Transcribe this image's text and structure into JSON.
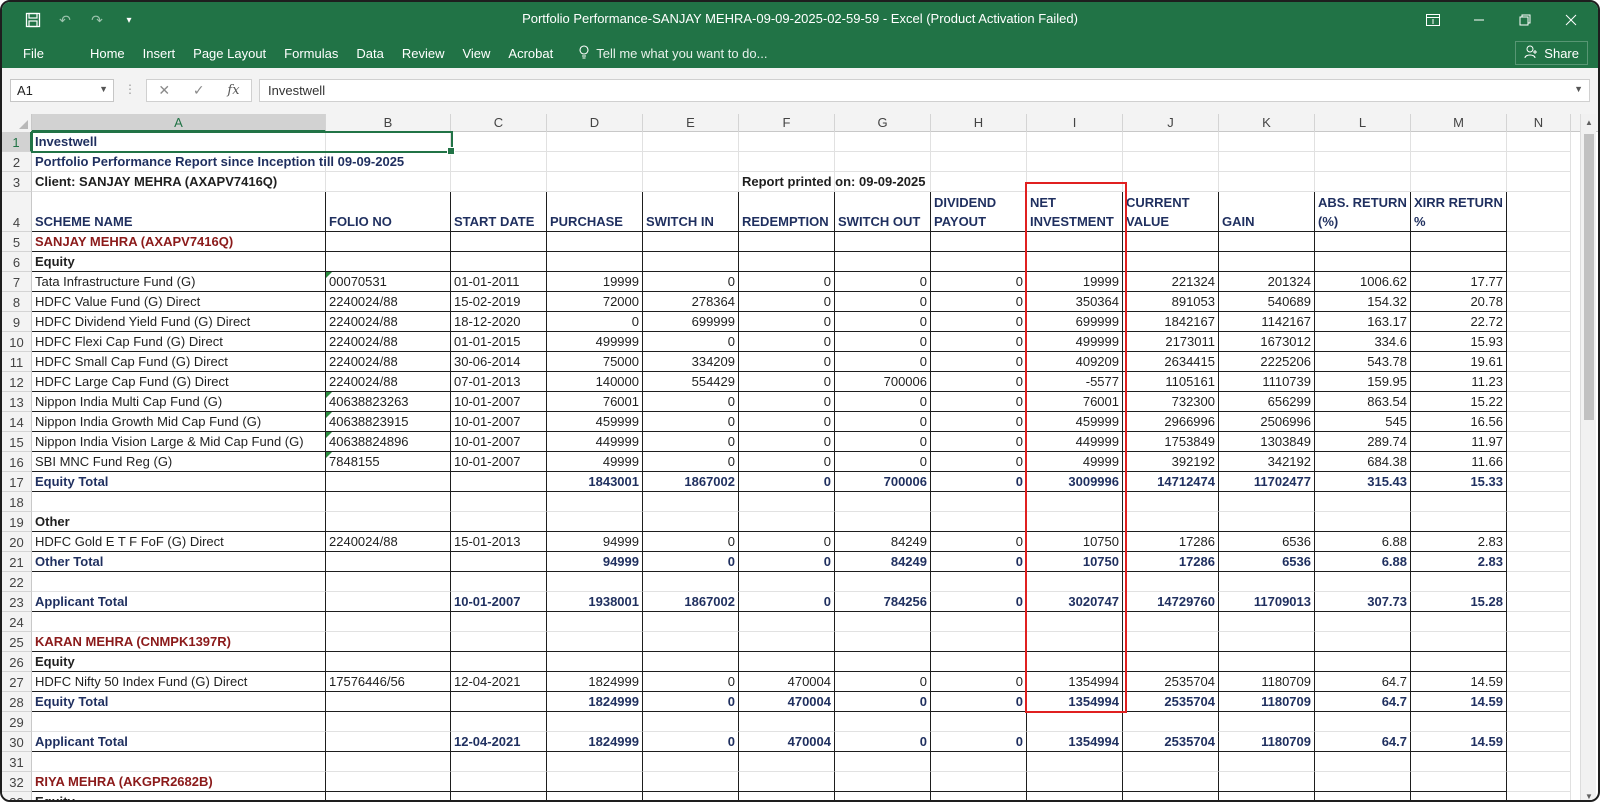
{
  "window": {
    "title": "Portfolio Performance-SANJAY MEHRA-09-09-2025-02-59-59  -  Excel (Product Activation Failed)"
  },
  "ribbon": {
    "tabs": [
      "File",
      "Home",
      "Insert",
      "Page Layout",
      "Formulas",
      "Data",
      "Review",
      "View",
      "Acrobat"
    ],
    "tell_me": "Tell me what you want to do...",
    "share": "Share"
  },
  "formula_bar": {
    "name_box": "A1",
    "content": "Investwell"
  },
  "columns": [
    "A",
    "B",
    "C",
    "D",
    "E",
    "F",
    "G",
    "H",
    "I",
    "J",
    "K",
    "L",
    "M",
    "N"
  ],
  "header_row": {
    "scheme_name": "SCHEME NAME",
    "folio_no": "FOLIO NO",
    "start_date": "START DATE",
    "purchase": "PURCHASE",
    "switch_in": "SWITCH IN",
    "redemption": "REDEMPTION",
    "switch_out": "SWITCH OUT",
    "dividend_payout": "DIVIDEND PAYOUT",
    "net_investment": "NET INVESTMENT",
    "current_value": "CURRENT VALUE",
    "gain": "GAIN",
    "abs_return": "ABS.  RETURN (%)",
    "xirr_return": "XIRR RETURN %"
  },
  "rows": [
    {
      "num": "1",
      "cells": {
        "A": "Investwell"
      },
      "style": "title"
    },
    {
      "num": "2",
      "cells": {
        "A": "Portfolio Performance Report since Inception till 09-09-2025"
      },
      "style": "title"
    },
    {
      "num": "3",
      "cells": {
        "A": "Client: SANJAY MEHRA (AXAPV7416Q)",
        "F": "Report printed on: 09-09-2025"
      },
      "style": "client"
    },
    {
      "num": "4",
      "cells": {},
      "style": "header"
    },
    {
      "num": "5",
      "cells": {
        "A": "SANJAY MEHRA (AXAPV7416Q)"
      },
      "style": "applicant"
    },
    {
      "num": "6",
      "cells": {
        "A": "Equity"
      },
      "style": "category"
    },
    {
      "num": "7",
      "cells": {
        "A": "Tata Infrastructure Fund (G)",
        "B": "00070531",
        "C": "01-01-2011",
        "D": "19999",
        "E": "0",
        "F": "0",
        "G": "0",
        "H": "0",
        "I": "19999",
        "J": "221324",
        "K": "201324",
        "L": "1006.62",
        "M": "17.77"
      },
      "style": "data",
      "flag_b": true
    },
    {
      "num": "8",
      "cells": {
        "A": "HDFC Value Fund (G) Direct",
        "B": "2240024/88",
        "C": "15-02-2019",
        "D": "72000",
        "E": "278364",
        "F": "0",
        "G": "0",
        "H": "0",
        "I": "350364",
        "J": "891053",
        "K": "540689",
        "L": "154.32",
        "M": "20.78"
      },
      "style": "data"
    },
    {
      "num": "9",
      "cells": {
        "A": "HDFC Dividend Yield Fund (G) Direct",
        "B": "2240024/88",
        "C": "18-12-2020",
        "D": "0",
        "E": "699999",
        "F": "0",
        "G": "0",
        "H": "0",
        "I": "699999",
        "J": "1842167",
        "K": "1142167",
        "L": "163.17",
        "M": "22.72"
      },
      "style": "data"
    },
    {
      "num": "10",
      "cells": {
        "A": "HDFC Flexi Cap Fund (G) Direct",
        "B": "2240024/88",
        "C": "01-01-2015",
        "D": "499999",
        "E": "0",
        "F": "0",
        "G": "0",
        "H": "0",
        "I": "499999",
        "J": "2173011",
        "K": "1673012",
        "L": "334.6",
        "M": "15.93"
      },
      "style": "data"
    },
    {
      "num": "11",
      "cells": {
        "A": "HDFC Small Cap Fund (G) Direct",
        "B": "2240024/88",
        "C": "30-06-2014",
        "D": "75000",
        "E": "334209",
        "F": "0",
        "G": "0",
        "H": "0",
        "I": "409209",
        "J": "2634415",
        "K": "2225206",
        "L": "543.78",
        "M": "19.61"
      },
      "style": "data"
    },
    {
      "num": "12",
      "cells": {
        "A": "HDFC Large Cap Fund (G) Direct",
        "B": "2240024/88",
        "C": "07-01-2013",
        "D": "140000",
        "E": "554429",
        "F": "0",
        "G": "700006",
        "H": "0",
        "I": "-5577",
        "J": "1105161",
        "K": "1110739",
        "L": "159.95",
        "M": "11.23"
      },
      "style": "data"
    },
    {
      "num": "13",
      "cells": {
        "A": "Nippon India Multi Cap Fund (G)",
        "B": "40638823263",
        "C": "10-01-2007",
        "D": "76001",
        "E": "0",
        "F": "0",
        "G": "0",
        "H": "0",
        "I": "76001",
        "J": "732300",
        "K": "656299",
        "L": "863.54",
        "M": "15.22"
      },
      "style": "data",
      "flag_b": true
    },
    {
      "num": "14",
      "cells": {
        "A": "Nippon India Growth Mid Cap Fund (G)",
        "B": "40638823915",
        "C": "10-01-2007",
        "D": "459999",
        "E": "0",
        "F": "0",
        "G": "0",
        "H": "0",
        "I": "459999",
        "J": "2966996",
        "K": "2506996",
        "L": "545",
        "M": "16.56"
      },
      "style": "data",
      "flag_b": true
    },
    {
      "num": "15",
      "cells": {
        "A": "Nippon India Vision Large & Mid Cap Fund (G)",
        "B": "40638824896",
        "C": "10-01-2007",
        "D": "449999",
        "E": "0",
        "F": "0",
        "G": "0",
        "H": "0",
        "I": "449999",
        "J": "1753849",
        "K": "1303849",
        "L": "289.74",
        "M": "11.97"
      },
      "style": "data",
      "flag_b": true
    },
    {
      "num": "16",
      "cells": {
        "A": "SBI MNC Fund Reg (G)",
        "B": "7848155",
        "C": "10-01-2007",
        "D": "49999",
        "E": "0",
        "F": "0",
        "G": "0",
        "H": "0",
        "I": "49999",
        "J": "392192",
        "K": "342192",
        "L": "684.38",
        "M": "11.66"
      },
      "style": "data",
      "flag_b": true
    },
    {
      "num": "17",
      "cells": {
        "A": "Equity Total",
        "D": "1843001",
        "E": "1867002",
        "F": "0",
        "G": "700006",
        "H": "0",
        "I": "3009996",
        "J": "14712474",
        "K": "11702477",
        "L": "315.43",
        "M": "15.33"
      },
      "style": "total"
    },
    {
      "num": "18",
      "cells": {},
      "style": "blank"
    },
    {
      "num": "19",
      "cells": {
        "A": "Other"
      },
      "style": "category"
    },
    {
      "num": "20",
      "cells": {
        "A": "HDFC Gold E T F FoF (G) Direct",
        "B": "2240024/88",
        "C": "15-01-2013",
        "D": "94999",
        "E": "0",
        "F": "0",
        "G": "84249",
        "H": "0",
        "I": "10750",
        "J": "17286",
        "K": "6536",
        "L": "6.88",
        "M": "2.83"
      },
      "style": "data"
    },
    {
      "num": "21",
      "cells": {
        "A": "Other Total",
        "D": "94999",
        "E": "0",
        "F": "0",
        "G": "84249",
        "H": "0",
        "I": "10750",
        "J": "17286",
        "K": "6536",
        "L": "6.88",
        "M": "2.83"
      },
      "style": "total"
    },
    {
      "num": "22",
      "cells": {},
      "style": "blank"
    },
    {
      "num": "23",
      "cells": {
        "A": "Applicant Total",
        "C": "10-01-2007",
        "D": "1938001",
        "E": "1867002",
        "F": "0",
        "G": "784256",
        "H": "0",
        "I": "3020747",
        "J": "14729760",
        "K": "11709013",
        "L": "307.73",
        "M": "15.28"
      },
      "style": "total"
    },
    {
      "num": "24",
      "cells": {},
      "style": "blank"
    },
    {
      "num": "25",
      "cells": {
        "A": "KARAN MEHRA (CNMPK1397R)"
      },
      "style": "applicant"
    },
    {
      "num": "26",
      "cells": {
        "A": "Equity"
      },
      "style": "category"
    },
    {
      "num": "27",
      "cells": {
        "A": "HDFC Nifty 50 Index Fund (G) Direct",
        "B": "17576446/56",
        "C": "12-04-2021",
        "D": "1824999",
        "E": "0",
        "F": "470004",
        "G": "0",
        "H": "0",
        "I": "1354994",
        "J": "2535704",
        "K": "1180709",
        "L": "64.7",
        "M": "14.59"
      },
      "style": "data"
    },
    {
      "num": "28",
      "cells": {
        "A": "Equity Total",
        "D": "1824999",
        "E": "0",
        "F": "470004",
        "G": "0",
        "H": "0",
        "I": "1354994",
        "J": "2535704",
        "K": "1180709",
        "L": "64.7",
        "M": "14.59"
      },
      "style": "total"
    },
    {
      "num": "29",
      "cells": {},
      "style": "blank"
    },
    {
      "num": "30",
      "cells": {
        "A": "Applicant Total",
        "C": "12-04-2021",
        "D": "1824999",
        "E": "0",
        "F": "470004",
        "G": "0",
        "H": "0",
        "I": "1354994",
        "J": "2535704",
        "K": "1180709",
        "L": "64.7",
        "M": "14.59"
      },
      "style": "total"
    },
    {
      "num": "31",
      "cells": {},
      "style": "blank"
    },
    {
      "num": "32",
      "cells": {
        "A": "RIYA MEHRA (AKGPR2682B)"
      },
      "style": "applicant"
    },
    {
      "num": "33",
      "cells": {
        "A": "Equity"
      },
      "style": "category"
    }
  ],
  "colors": {
    "excel_green": "#217346",
    "highlight_red": "#e02020",
    "navy_text": "#1f2f5f",
    "maroon_text": "#8b1a1a"
  }
}
